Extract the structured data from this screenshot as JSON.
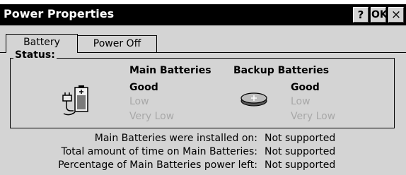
{
  "window": {
    "title": "Power Properties",
    "help_label": "?",
    "ok_label": "OK",
    "close_label": "×"
  },
  "tabs": [
    {
      "label": "Battery",
      "active": true
    },
    {
      "label": "Power Off",
      "active": false
    }
  ],
  "status": {
    "group_label": "Status:",
    "main": {
      "heading": "Main Batteries",
      "levels": [
        "Good",
        "Low",
        "Very Low"
      ],
      "current": "Good",
      "icon": "main-battery-icon"
    },
    "backup": {
      "heading": "Backup Batteries",
      "levels": [
        "Good",
        "Low",
        "Very Low"
      ],
      "current": "Good",
      "icon": "backup-battery-icon"
    }
  },
  "info": [
    {
      "label": "Main Batteries were installed on:",
      "value": "Not supported"
    },
    {
      "label": "Total amount of time on Main Batteries:",
      "value": "Not supported"
    },
    {
      "label": "Percentage of Main Batteries power left:",
      "value": "Not supported"
    }
  ],
  "colors": {
    "face": "#d4d4d4",
    "titlebar": "#000000",
    "disabled_text": "#a8a8a8"
  }
}
